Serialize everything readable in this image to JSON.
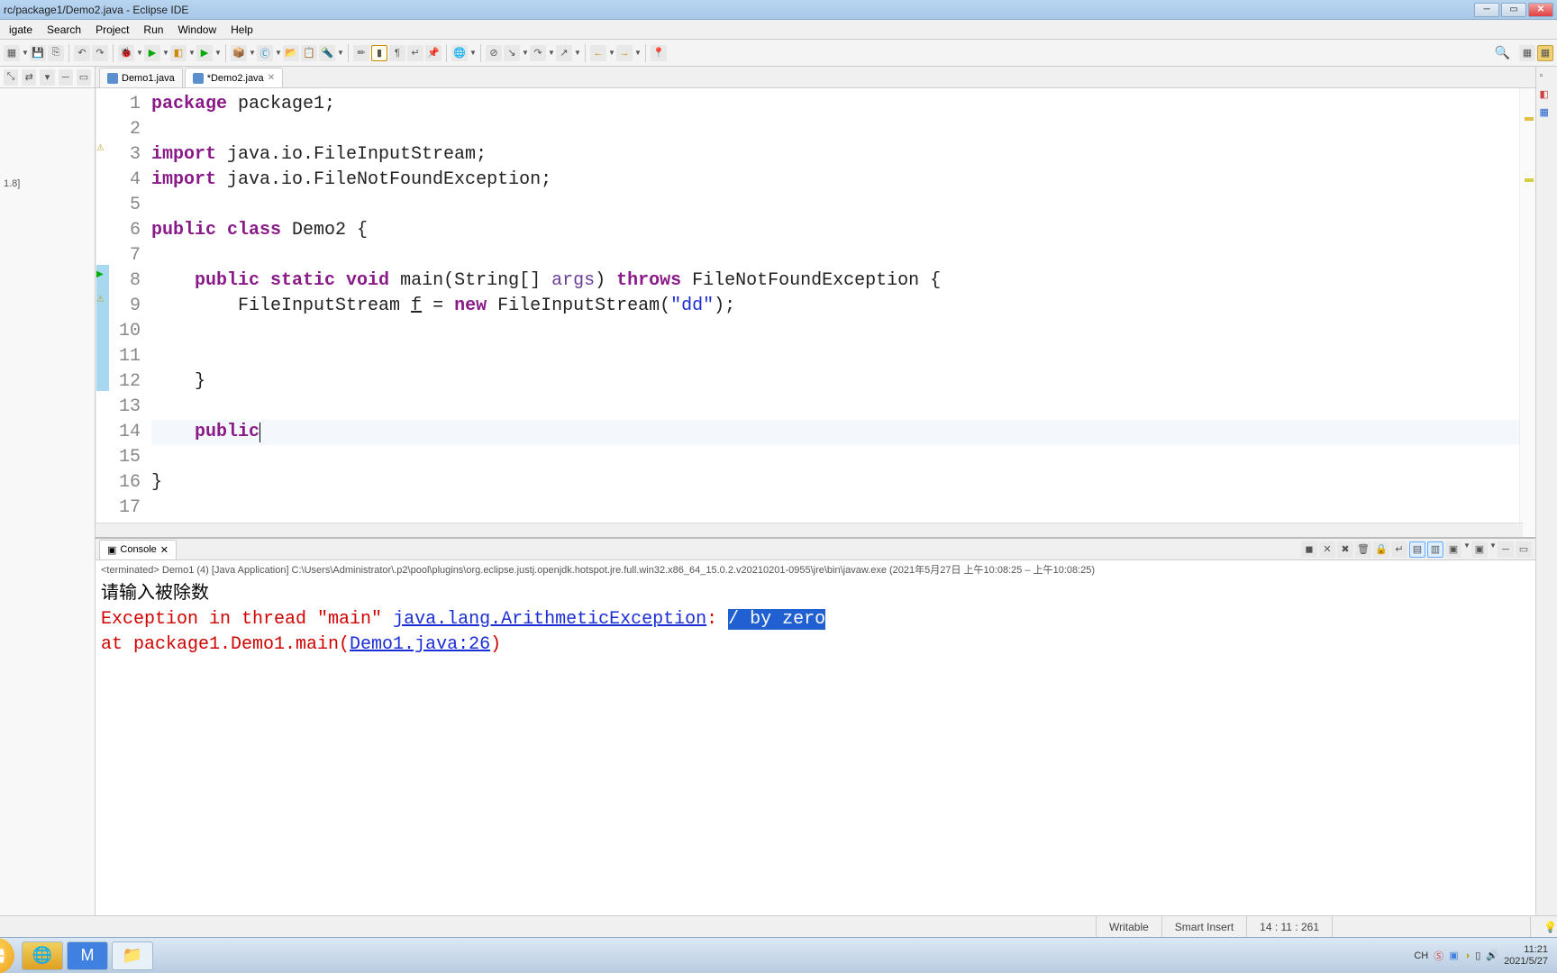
{
  "title": "rc/package1/Demo2.java - Eclipse IDE",
  "menu": [
    "igate",
    "Search",
    "Project",
    "Run",
    "Window",
    "Help"
  ],
  "left": {
    "version": "1.8]"
  },
  "tabs": [
    {
      "label": "Demo1.java",
      "active": false
    },
    {
      "label": "*Demo2.java",
      "active": true
    }
  ],
  "code": {
    "lines": [
      {
        "n": 1,
        "tok": [
          [
            "kw",
            "package"
          ],
          [
            "p",
            " package1;"
          ]
        ]
      },
      {
        "n": 2,
        "tok": []
      },
      {
        "n": 3,
        "tok": [
          [
            "kw",
            "import"
          ],
          [
            "p",
            " java.io.FileInputStream;"
          ]
        ],
        "mark": "warn"
      },
      {
        "n": 4,
        "tok": [
          [
            "kw",
            "import"
          ],
          [
            "p",
            " java.io.FileNotFoundException;"
          ]
        ]
      },
      {
        "n": 5,
        "tok": []
      },
      {
        "n": 6,
        "tok": [
          [
            "kw",
            "public class"
          ],
          [
            "p",
            " Demo2 {"
          ]
        ]
      },
      {
        "n": 7,
        "tok": []
      },
      {
        "n": 8,
        "tok": [
          [
            "p",
            "    "
          ],
          [
            "kw",
            "public static void"
          ],
          [
            "p",
            " main(String[] "
          ],
          [
            "arg",
            "args"
          ],
          [
            "p",
            ") "
          ],
          [
            "kw",
            "throws"
          ],
          [
            "p",
            " FileNotFoundException {"
          ]
        ],
        "hl": true,
        "mark": "tri"
      },
      {
        "n": 9,
        "tok": [
          [
            "p",
            "        FileInputStream "
          ],
          [
            "link",
            "f"
          ],
          [
            "p",
            " = "
          ],
          [
            "kw",
            "new"
          ],
          [
            "p",
            " FileInputStream("
          ],
          [
            "str",
            "\"dd\""
          ],
          [
            "p",
            ");"
          ]
        ],
        "hl": true,
        "mark": "warn"
      },
      {
        "n": 10,
        "tok": [],
        "hl": true
      },
      {
        "n": 11,
        "tok": [],
        "hl": true
      },
      {
        "n": 12,
        "tok": [
          [
            "p",
            "    }"
          ]
        ],
        "hl": true
      },
      {
        "n": 13,
        "tok": []
      },
      {
        "n": 14,
        "tok": [
          [
            "p",
            "    "
          ],
          [
            "kw",
            "public"
          ]
        ],
        "cursor": true,
        "current": true
      },
      {
        "n": 15,
        "tok": []
      },
      {
        "n": 16,
        "tok": [
          [
            "p",
            "}"
          ]
        ]
      },
      {
        "n": 17,
        "tok": []
      }
    ]
  },
  "console": {
    "tab": "Console",
    "info": "<terminated> Demo1 (4) [Java Application] C:\\Users\\Administrator\\.p2\\pool\\plugins\\org.eclipse.justj.openjdk.hotspot.jre.full.win32.x86_64_15.0.2.v20210201-0955\\jre\\bin\\javaw.exe  (2021年5月27日 上午10:08:25 – 上午10:08:25)",
    "line1": "请输入被除数",
    "err_pre": "Exception in thread \"main\" ",
    "err_link1": "java.lang.ArithmeticException",
    "err_mid": ": ",
    "err_hl": "/ by zero",
    "err_at": "        at package1.Demo1.main(",
    "err_link2": "Demo1.java:26",
    "err_close": ")"
  },
  "status": {
    "writable": "Writable",
    "insert": "Smart Insert",
    "pos": "14 : 11 : 261"
  },
  "tray": {
    "lang": "CH",
    "time": "11:21",
    "date": "2021/5/27"
  }
}
